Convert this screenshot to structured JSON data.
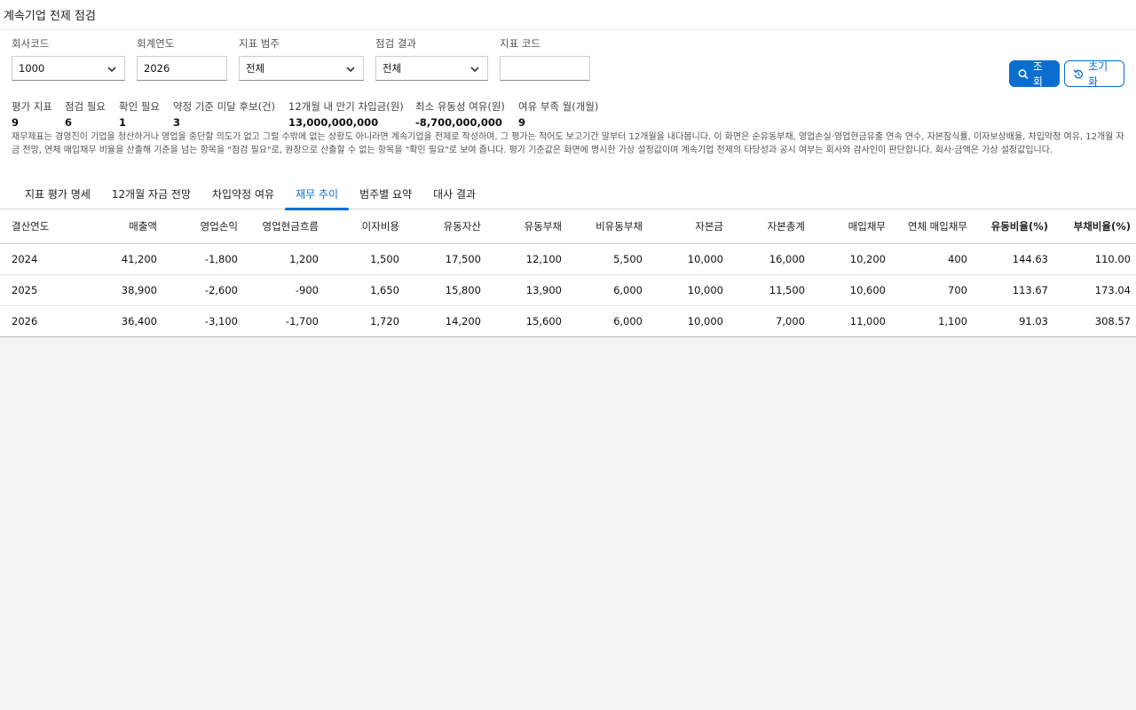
{
  "app": {
    "title": "계속기업 전제 점검"
  },
  "filters": {
    "company_code": {
      "label": "회사코드",
      "value": "1000"
    },
    "fiscal_year": {
      "label": "회계연도",
      "value": "2026"
    },
    "category": {
      "label": "지표 범주",
      "value": "전체"
    },
    "result": {
      "label": "점검 결과",
      "value": "전체"
    },
    "indicator_code": {
      "label": "지표 코드",
      "value": ""
    }
  },
  "actions": {
    "search_label": "조회",
    "reset_label": "초기화"
  },
  "kpis": [
    {
      "label": "평가 지표",
      "value": "9"
    },
    {
      "label": "점검 필요",
      "value": "6"
    },
    {
      "label": "확인 필요",
      "value": "1"
    },
    {
      "label": "약정 기준 미달 후보(건)",
      "value": "3"
    },
    {
      "label": "12개월 내 만기 차입금(원)",
      "value": "13,000,000,000"
    },
    {
      "label": "최소 유동성 여유(원)",
      "value": "-8,700,000,000"
    },
    {
      "label": "여유 부족 월(개월)",
      "value": "9"
    }
  ],
  "description": "재무제표는 경영진이 기업을 청산하거나 영업을 중단할 의도가 없고 그럴 수밖에 없는 상황도 아니라면 계속기업을 전제로 작성하며, 그 평가는 적어도 보고기간 말부터 12개월을 내다봅니다. 이 화면은 순유동부채, 영업손실·영업현금유출 연속 연수, 자본잠식률, 이자보상배율, 차입약정 여유, 12개월 자금 전망, 연체 매입채무 비율을 산출해 기준을 넘는 항목을 \"점검 필요\"로, 원장으로 산출할 수 없는 항목을 \"확인 필요\"로 보여 줍니다. 평가 기준값은 화면에 명시한 가상 설정값이며 계속기업 전제의 타당성과 공시 여부는 회사와 감사인이 판단합니다. 회사·금액은 가상 설정값입니다.",
  "tabs": [
    {
      "label": "지표 평가 명세",
      "active": false
    },
    {
      "label": "12개월 자금 전망",
      "active": false
    },
    {
      "label": "차입약정 여유",
      "active": false
    },
    {
      "label": "재무 추이",
      "active": true
    },
    {
      "label": "범주별 요약",
      "active": false
    },
    {
      "label": "대사 결과",
      "active": false
    }
  ],
  "table": {
    "columns": [
      "결산연도",
      "매출액",
      "영업손익",
      "영업현금흐름",
      "이자비용",
      "유동자산",
      "유동부채",
      "비유동부채",
      "자본금",
      "자본총계",
      "매입채무",
      "연체 매입채무",
      "유동비율(%)",
      "부채비율(%)"
    ],
    "rows": [
      [
        "2024",
        "41,200",
        "-1,800",
        "1,200",
        "1,500",
        "17,500",
        "12,100",
        "5,500",
        "10,000",
        "16,000",
        "10,200",
        "400",
        "144.63",
        "110.00"
      ],
      [
        "2025",
        "38,900",
        "-2,600",
        "-900",
        "1,650",
        "15,800",
        "13,900",
        "6,000",
        "10,000",
        "11,500",
        "10,600",
        "700",
        "113.67",
        "173.04"
      ],
      [
        "2026",
        "36,400",
        "-3,100",
        "-1,700",
        "1,720",
        "14,200",
        "15,600",
        "6,000",
        "10,000",
        "7,000",
        "11,000",
        "1,100",
        "91.03",
        "308.57"
      ]
    ]
  }
}
